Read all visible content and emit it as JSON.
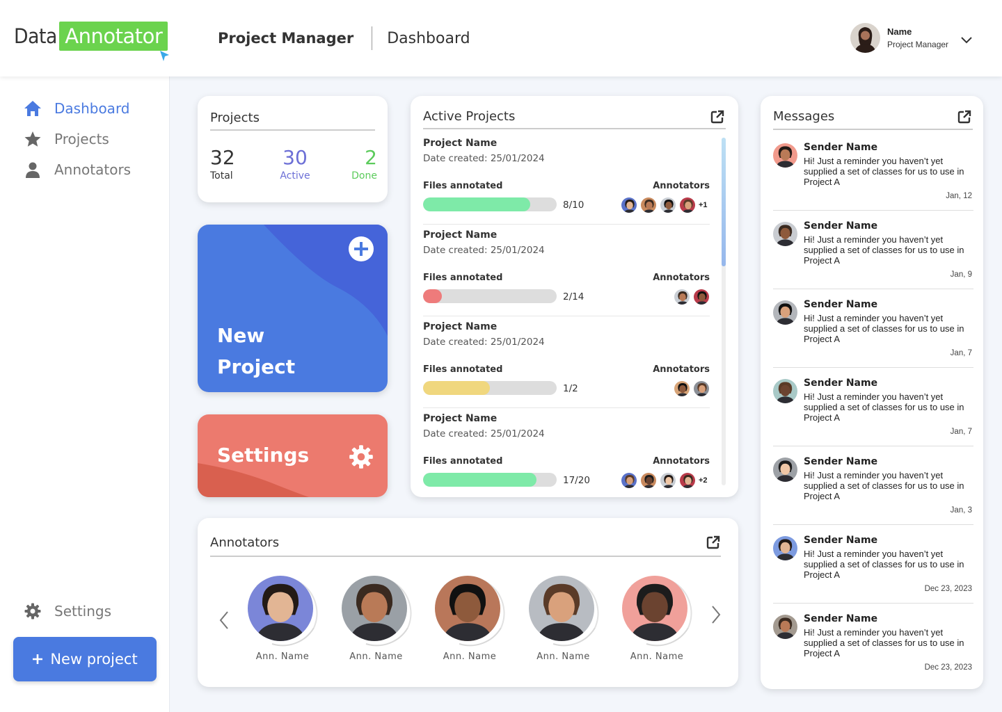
{
  "header": {
    "logo_data": "Data",
    "logo_annotator": "Annotator",
    "breadcrumb_section": "Project Manager",
    "breadcrumb_page": "Dashboard",
    "user_name": "Name",
    "user_role": "Project Manager"
  },
  "sidebar": {
    "items": [
      {
        "label": "Dashboard",
        "icon": "home-icon",
        "active": true
      },
      {
        "label": "Projects",
        "icon": "star-icon",
        "active": false
      },
      {
        "label": "Annotators",
        "icon": "user-icon",
        "active": false
      }
    ],
    "settings_label": "Settings",
    "new_project_label": "New project"
  },
  "projects_card": {
    "title": "Projects",
    "stats": [
      {
        "value": "32",
        "label": "Total",
        "color": "#333333"
      },
      {
        "value": "30",
        "label": "Active",
        "color": "#6c6fd6"
      },
      {
        "value": "2",
        "label": "Done",
        "color": "#5bcb5b"
      }
    ]
  },
  "tiles": {
    "new_project_line1": "New",
    "new_project_line2": "Project",
    "settings": "Settings"
  },
  "active_projects": {
    "title": "Active Projects",
    "files_label": "Files annotated",
    "annotators_label": "Annotators",
    "items": [
      {
        "name": "Project Name",
        "date": "Date created: 25/01/2024",
        "done": 8,
        "total": 10,
        "count": "8/10",
        "color": "#7eeaa8",
        "annotators": 4,
        "extra": "+1"
      },
      {
        "name": "Project Name",
        "date": "Date created: 25/01/2024",
        "done": 2,
        "total": 14,
        "count": "2/14",
        "color": "#ee7b7b",
        "annotators": 2,
        "extra": ""
      },
      {
        "name": "Project Name",
        "date": "Date created: 25/01/2024",
        "done": 1,
        "total": 2,
        "count": "1/2",
        "color": "#f0d77e",
        "annotators": 2,
        "extra": ""
      },
      {
        "name": "Project Name",
        "date": "Date created: 25/01/2024",
        "done": 17,
        "total": 20,
        "count": "17/20",
        "color": "#7eeaa8",
        "annotators": 4,
        "extra": "+2"
      }
    ]
  },
  "annotators_card": {
    "title": "Annotators",
    "people": [
      {
        "name": "Ann. Name",
        "bg": "#7b86d8"
      },
      {
        "name": "Ann. Name",
        "bg": "#9aa0a6"
      },
      {
        "name": "Ann. Name",
        "bg": "#b9775a"
      },
      {
        "name": "Ann. Name",
        "bg": "#b8bcc2"
      },
      {
        "name": "Ann. Name",
        "bg": "#f0a09a"
      }
    ]
  },
  "messages": {
    "title": "Messages",
    "items": [
      {
        "sender": "Sender Name",
        "text": "Hi! Just a reminder you haven’t yet supplied a set of classes for us to use in Project A",
        "date": "Jan, 12",
        "bg": "#f19a8c"
      },
      {
        "sender": "Sender Name",
        "text": "Hi! Just a reminder you haven’t yet supplied a set of classes for us to use in Project A",
        "date": "Jan, 9",
        "bg": "#c9ccd1"
      },
      {
        "sender": "Sender Name",
        "text": "Hi! Just a reminder you haven’t yet supplied a set of classes for us to use in Project A",
        "date": "Jan, 7",
        "bg": "#b3b6bb"
      },
      {
        "sender": "Sender Name",
        "text": "Hi! Just a reminder you haven’t yet supplied a set of classes for us to use in Project A",
        "date": "Jan, 7",
        "bg": "#a8c9c7"
      },
      {
        "sender": "Sender Name",
        "text": "Hi! Just a reminder you haven’t yet supplied a set of classes for us to use in Project A",
        "date": "Jan, 3",
        "bg": "#9da1a6"
      },
      {
        "sender": "Sender Name",
        "text": "Hi! Just a reminder you haven’t yet supplied a set of classes for us to use in Project A",
        "date": "Dec 23, 2023",
        "bg": "#7d9be0"
      },
      {
        "sender": "Sender Name",
        "text": "Hi! Just a reminder you haven’t yet supplied a set of classes for us to use in Project A",
        "date": "Dec 23, 2023",
        "bg": "#a39a90"
      }
    ]
  }
}
